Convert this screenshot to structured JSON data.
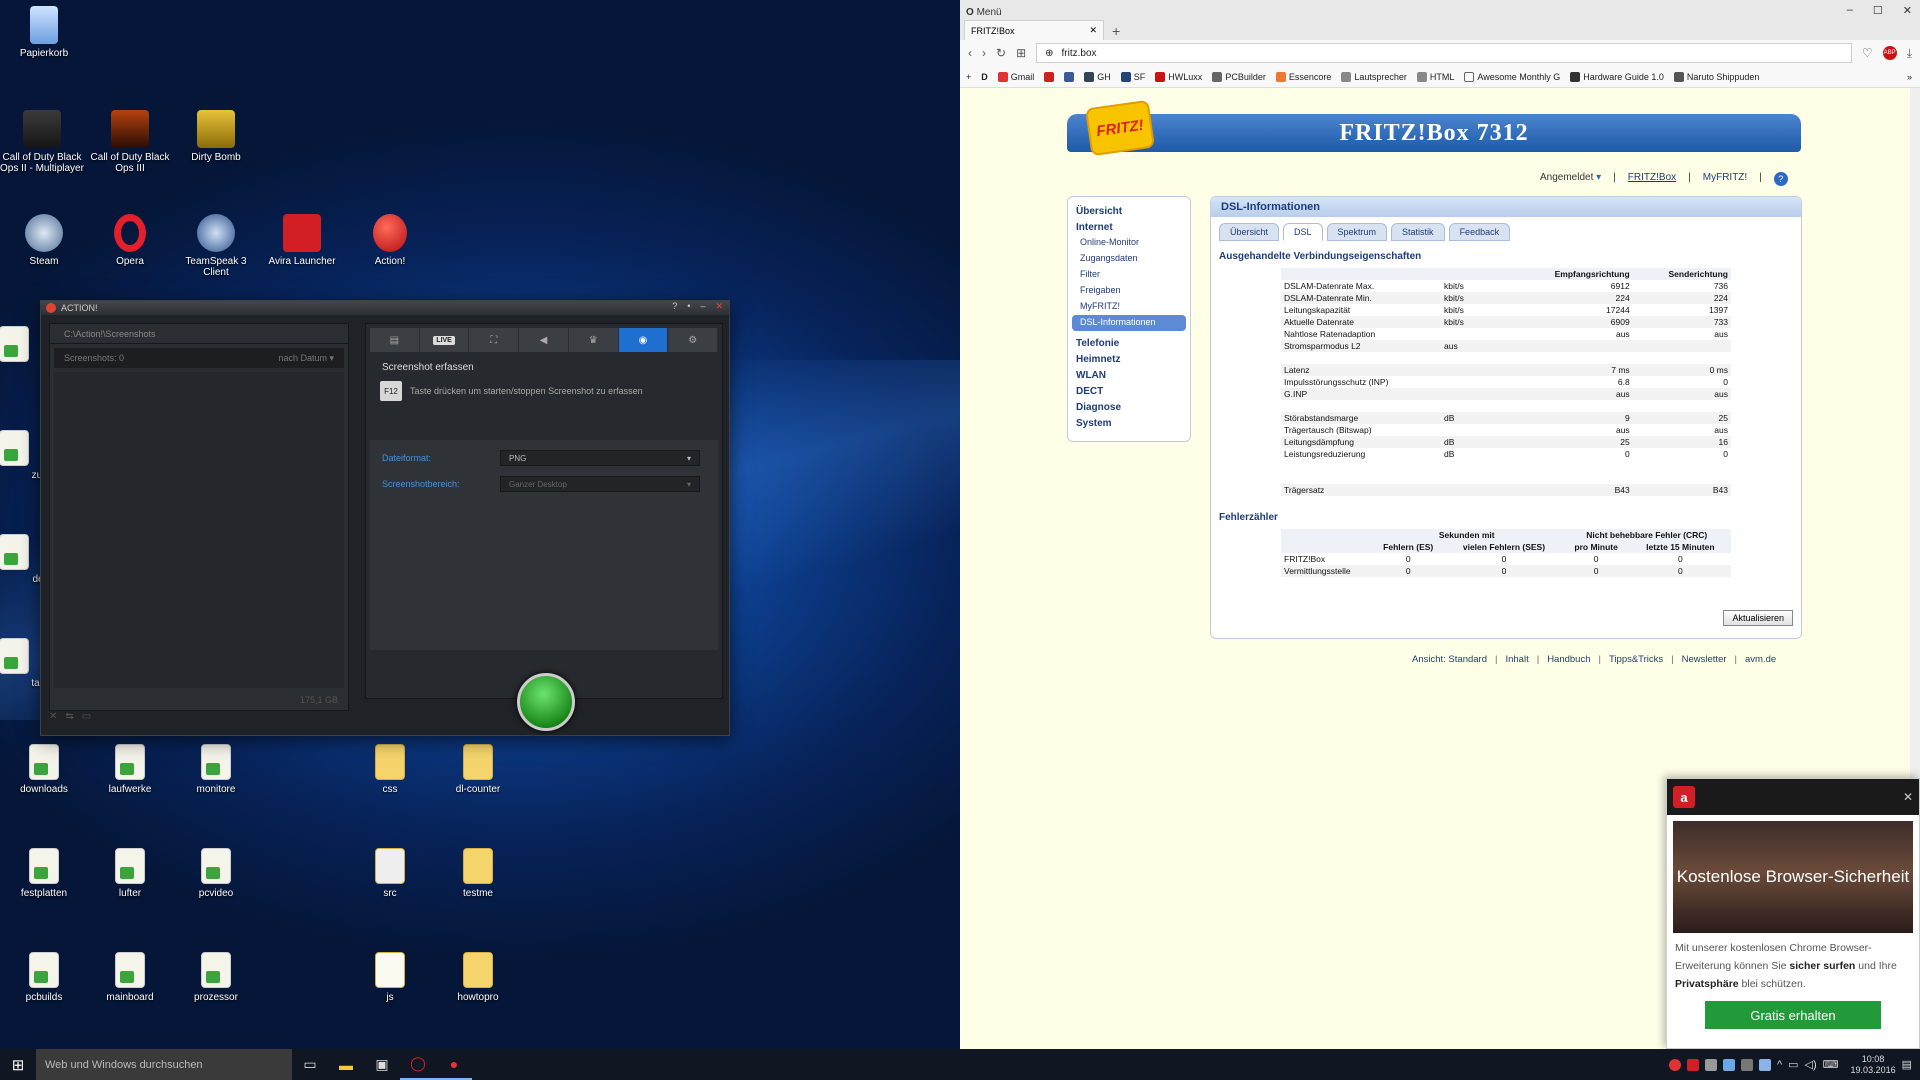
{
  "desktop": {
    "icons": [
      {
        "label": "Papierkorb"
      },
      {
        "label": "Call of Duty Black Ops II - Multiplayer"
      },
      {
        "label": "Call of Duty Black Ops III"
      },
      {
        "label": "Dirty Bomb"
      },
      {
        "label": "Steam"
      },
      {
        "label": "Opera"
      },
      {
        "label": "TeamSpeak 3 Client"
      },
      {
        "label": "Avira Launcher"
      },
      {
        "label": "Action!"
      },
      {
        "label": "downloads"
      },
      {
        "label": "laufwerke"
      },
      {
        "label": "monitore"
      },
      {
        "label": "css"
      },
      {
        "label": "dl-counter"
      },
      {
        "label": "festplatten"
      },
      {
        "label": "lufter"
      },
      {
        "label": "pcvideo"
      },
      {
        "label": "src"
      },
      {
        "label": "testme"
      },
      {
        "label": "pcbuilds"
      },
      {
        "label": "mainboard"
      },
      {
        "label": "prozessor"
      },
      {
        "label": "js"
      },
      {
        "label": "howtopro"
      }
    ],
    "partial_labels": [
      "zul",
      "de",
      "tas"
    ]
  },
  "taskbar": {
    "search_placeholder": "Web und Windows durchsuchen",
    "clock_time": "10:08",
    "clock_date": "19.03.2016"
  },
  "action_app": {
    "title": "ACTION!",
    "path": "C:\\Action!\\Screenshots",
    "screenshots_count": "Screenshots: 0",
    "sort_label": "nach Datum",
    "free_space": "175,1 GB",
    "live_label": "LIVE",
    "section_title": "Screenshot erfassen",
    "hotkey": "F12",
    "hotkey_hint": "Taste drücken um starten/stoppen Screenshot zu erfassen",
    "format_label": "Dateiformat:",
    "format_value": "PNG",
    "area_label": "Screenshotbereich:",
    "area_value": "Ganzer Desktop"
  },
  "browser": {
    "menu_label": "Menü",
    "tab_title": "FRITZ!Box",
    "url": "fritz.box",
    "bookmarks": [
      "D",
      "Gmail",
      "F",
      "GH",
      "SF",
      "HWLuxx",
      "PCBuilder",
      "Essencore",
      "Lautsprecher",
      "HTML",
      "Awesome Monthly G",
      "Hardware Guide 1.0",
      "Naruto Shippuden"
    ],
    "colors": {
      "accent": "#1e5aa8",
      "page_bg": "#ffffe8"
    }
  },
  "fritz": {
    "logo": "FRITZ!",
    "banner": "FRITZ!Box 7312",
    "nav": {
      "logged_in": "Angemeldet",
      "box": "FRITZ!Box",
      "myfritz": "MyFRITZ!",
      "help": "?"
    },
    "menu": [
      {
        "label": "Übersicht",
        "level": 1
      },
      {
        "label": "Internet",
        "level": 1
      },
      {
        "label": "Online-Monitor",
        "level": 2
      },
      {
        "label": "Zugangsdaten",
        "level": 2
      },
      {
        "label": "Filter",
        "level": 2
      },
      {
        "label": "Freigaben",
        "level": 2
      },
      {
        "label": "MyFRITZ!",
        "level": 2
      },
      {
        "label": "DSL-Informationen",
        "level": 2,
        "selected": true
      },
      {
        "label": "Telefonie",
        "level": 1
      },
      {
        "label": "Heimnetz",
        "level": 1
      },
      {
        "label": "WLAN",
        "level": 1
      },
      {
        "label": "DECT",
        "level": 1
      },
      {
        "label": "Diagnose",
        "level": 1
      },
      {
        "label": "System",
        "level": 1
      }
    ],
    "content_title": "DSL-Informationen",
    "tabs": [
      "Übersicht",
      "DSL",
      "Spektrum",
      "Statistik",
      "Feedback"
    ],
    "selected_tab": "DSL",
    "section1": "Ausgehandelte Verbindungseigenschaften",
    "dsl_headers": [
      "",
      "",
      "Empfangsrichtung",
      "Senderichtung"
    ],
    "dsl_rows": [
      [
        "DSLAM-Datenrate Max.",
        "kbit/s",
        "6912",
        "736"
      ],
      [
        "DSLAM-Datenrate Min.",
        "kbit/s",
        "224",
        "224"
      ],
      [
        "Leitungskapazität",
        "kbit/s",
        "17244",
        "1397"
      ],
      [
        "Aktuelle Datenrate",
        "kbit/s",
        "6909",
        "733"
      ],
      [
        "Nahtlose Ratenadaption",
        "",
        "aus",
        "aus"
      ],
      [
        "Stromsparmodus L2",
        "aus",
        "",
        ""
      ],
      [
        "",
        "",
        "",
        ""
      ],
      [
        "Latenz",
        "",
        "7 ms",
        "0 ms"
      ],
      [
        "Impulsstörungsschutz (INP)",
        "",
        "6.8",
        "0"
      ],
      [
        "G.INP",
        "",
        "aus",
        "aus"
      ],
      [
        "",
        "",
        "",
        ""
      ],
      [
        "Störabstandsmarge",
        "dB",
        "9",
        "25"
      ],
      [
        "Trägertausch (Bitswap)",
        "",
        "aus",
        "aus"
      ],
      [
        "Leitungsdämpfung",
        "dB",
        "25",
        "16"
      ],
      [
        "Leistungsreduzierung",
        "dB",
        "0",
        "0"
      ],
      [
        "",
        "",
        "",
        ""
      ],
      [
        "",
        "",
        "",
        ""
      ],
      [
        "Trägersatz",
        "",
        "B43",
        "B43"
      ]
    ],
    "section2": "Fehlerzähler",
    "err_group1": "Sekunden mit",
    "err_group2": "Nicht behebbare Fehler (CRC)",
    "err_headers": [
      "",
      "Fehlern (ES)",
      "vielen Fehlern (SES)",
      "pro Minute",
      "letzte 15 Minuten"
    ],
    "err_rows": [
      [
        "FRITZ!Box",
        "0",
        "0",
        "0",
        "0"
      ],
      [
        "Vermittlungsstelle",
        "0",
        "0",
        "0",
        "0"
      ]
    ],
    "refresh_button": "Aktualisieren",
    "footer": [
      "Ansicht: Standard",
      "Inhalt",
      "Handbuch",
      "Tipps&Tricks",
      "Newsletter",
      "avm.de"
    ]
  },
  "avira_popup": {
    "headline": "Kostenlose Browser-Sicherheit",
    "text_1": "Mit unserer kostenlosen Chrome Browser-Erweiterung können Sie ",
    "text_bold1": "sicher surfen",
    "text_2": " und Ihre ",
    "text_bold2": "Privatsphäre",
    "text_3": " blei schützen.",
    "button": "Gratis erhalten"
  }
}
